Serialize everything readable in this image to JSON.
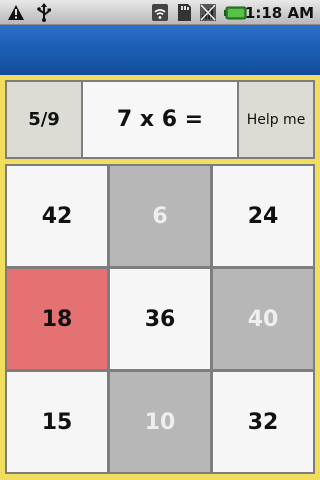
{
  "status_bar": {
    "time": "1:18 AM",
    "icons": [
      "warning-icon",
      "usb-icon",
      "wifi-icon",
      "sd-card-icon",
      "signal-icon",
      "battery-icon"
    ]
  },
  "quiz": {
    "progress": "5/9",
    "question": "7 x 6 =",
    "help_label": "Help me",
    "answers": [
      {
        "value": "42",
        "state": "normal"
      },
      {
        "value": "6",
        "state": "disabled"
      },
      {
        "value": "24",
        "state": "normal"
      },
      {
        "value": "18",
        "state": "wrong"
      },
      {
        "value": "36",
        "state": "normal"
      },
      {
        "value": "40",
        "state": "disabled"
      },
      {
        "value": "15",
        "state": "normal"
      },
      {
        "value": "10",
        "state": "disabled"
      },
      {
        "value": "32",
        "state": "normal"
      }
    ]
  },
  "colors": {
    "background": "#f2dd5e",
    "title_bar": "#1d5eb4",
    "tile_normal": "#f6f6f6",
    "tile_disabled": "#b7b7b7",
    "tile_wrong": "#e47272"
  }
}
